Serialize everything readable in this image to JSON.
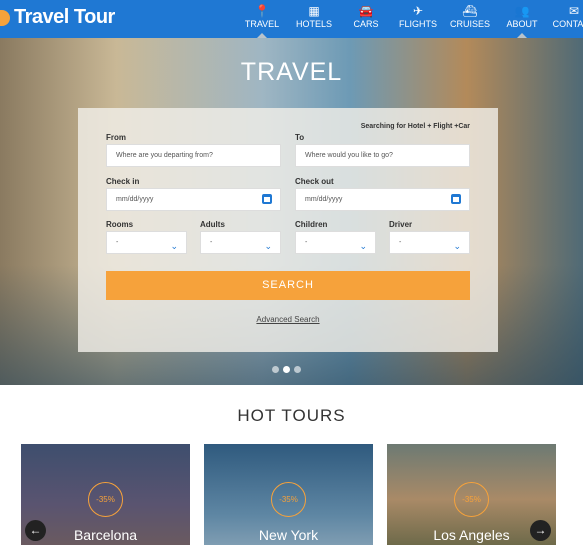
{
  "header": {
    "logo": "Travel Tour",
    "nav": [
      {
        "label": "TRAVEL",
        "icon": "map-pin-icon",
        "glyph": "📍",
        "active": true
      },
      {
        "label": "HOTELS",
        "icon": "building-icon",
        "glyph": "▦"
      },
      {
        "label": "CARS",
        "icon": "car-icon",
        "glyph": "🚘"
      },
      {
        "label": "FLIGHTS",
        "icon": "plane-icon",
        "glyph": "✈"
      },
      {
        "label": "CRUISES",
        "icon": "ship-icon",
        "glyph": "⛴"
      },
      {
        "label": "ABOUT",
        "icon": "people-icon",
        "glyph": "👥"
      },
      {
        "label": "CONTACT",
        "icon": "mail-icon",
        "glyph": "✉"
      }
    ]
  },
  "hero": {
    "title": "TRAVEL"
  },
  "form": {
    "searching": "Searching for Hotel + Flight +Car",
    "from_label": "From",
    "from_placeholder": "Where are you departing from?",
    "to_label": "To",
    "to_placeholder": "Where would you like to go?",
    "checkin_label": "Check in",
    "checkin_placeholder": "mm/dd/yyyy",
    "checkout_label": "Check out",
    "checkout_placeholder": "mm/dd/yyyy",
    "rooms_label": "Rooms",
    "rooms_value": "-",
    "adults_label": "Adults",
    "adults_value": "-",
    "children_label": "Children",
    "children_value": "-",
    "driver_label": "Driver",
    "driver_value": "-",
    "search_label": "SEARCH",
    "advanced_label": "Advanced Search"
  },
  "carousel": {
    "slides": 3,
    "active": 2
  },
  "hot_tours": {
    "title": "HOT TOURS",
    "tours": [
      {
        "city": "Barcelona",
        "discount": "-35%"
      },
      {
        "city": "New York",
        "discount": "-35%"
      },
      {
        "city": "Los Angeles",
        "discount": "-35%"
      }
    ]
  },
  "colors": {
    "header": "#1f78d3",
    "accent": "#f6a23b"
  }
}
